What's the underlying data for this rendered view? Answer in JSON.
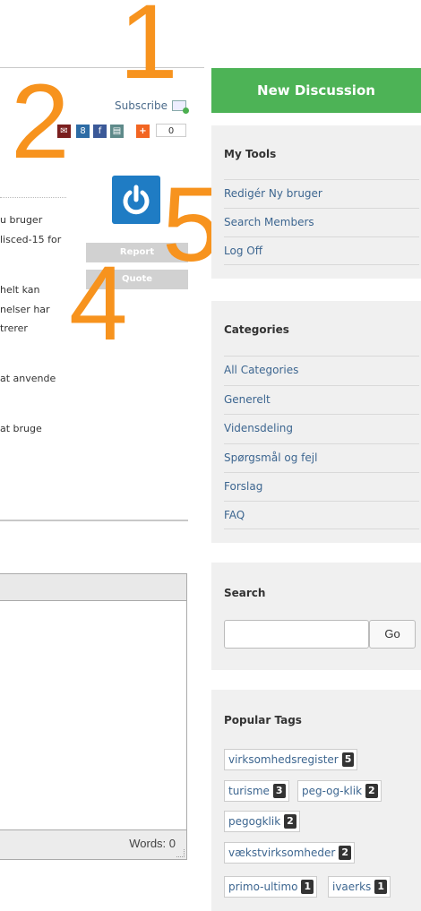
{
  "annotations": {
    "n1": "1",
    "n2": "2",
    "n4": "4",
    "n5": "5"
  },
  "share": {
    "subscribe_label": "Subscribe",
    "share_count": "0",
    "icons": [
      "email-icon",
      "google-plus-icon",
      "facebook-icon",
      "print-icon",
      "addthis-plus-icon"
    ]
  },
  "post": {
    "report_label": "Report",
    "quote_label": "Quote",
    "lines": [
      "u bruger",
      "lisced-15 for",
      "helt kan",
      "nelser har",
      "trerer",
      "at anvende",
      "at bruge"
    ]
  },
  "editor": {
    "words_label": "Words: 0"
  },
  "sidebar": {
    "new_discussion_label": "New Discussion",
    "tools": {
      "title": "My Tools",
      "items": [
        "Redigér Ny bruger",
        "Search Members",
        "Log Off"
      ]
    },
    "categories": {
      "title": "Categories",
      "items": [
        "All Categories",
        "Generelt",
        "Vidensdeling",
        "Spørgsmål og fejl",
        "Forslag",
        "FAQ"
      ]
    },
    "search": {
      "title": "Search",
      "button_label": "Go",
      "value": ""
    },
    "tags": {
      "title": "Popular Tags",
      "items": [
        {
          "label": "virksomhedsregister",
          "count": "5"
        },
        {
          "label": "turisme",
          "count": "3"
        },
        {
          "label": "peg-og-klik",
          "count": "2"
        },
        {
          "label": "pegogklik",
          "count": "2"
        },
        {
          "label": "vækstvirksomheder",
          "count": "2"
        },
        {
          "label": "primo-ultimo",
          "count": "1"
        },
        {
          "label": "ivaerks",
          "count": "1"
        }
      ]
    }
  },
  "colors": {
    "accent_green": "#4db356",
    "annotation_orange": "#f7931e",
    "link_blue": "#3d6690",
    "power_blue": "#1f7cc4"
  }
}
